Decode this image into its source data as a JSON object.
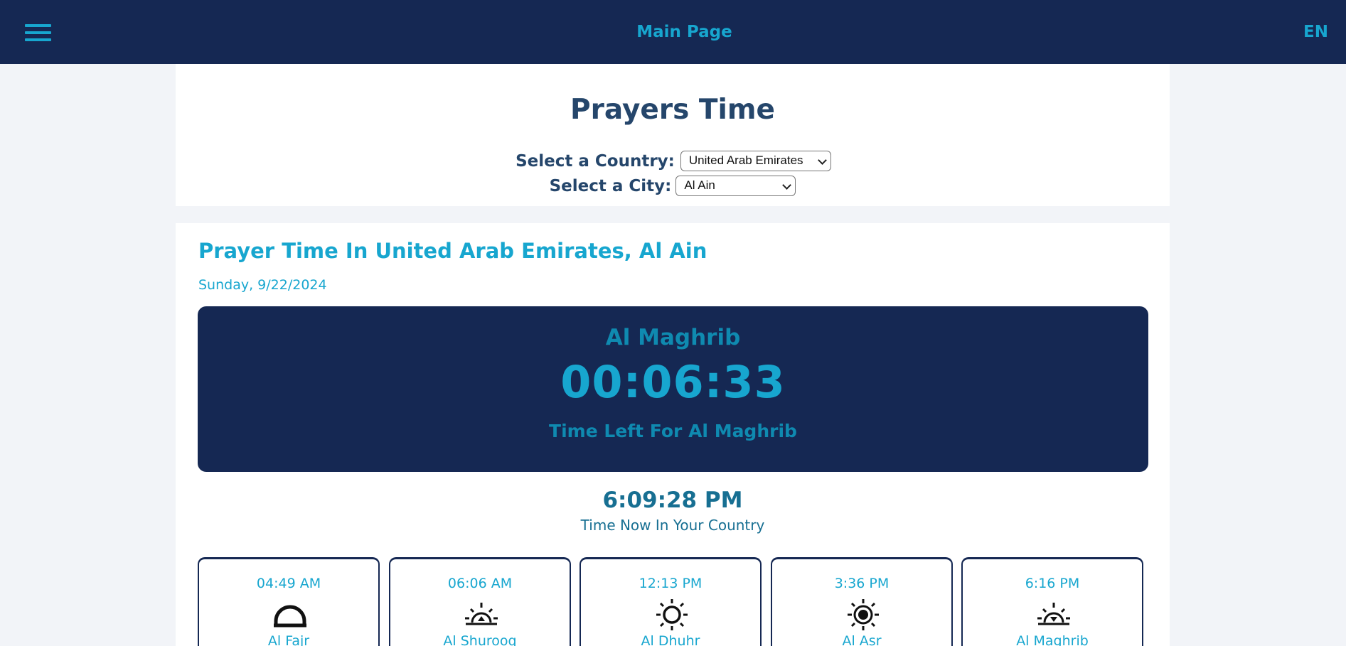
{
  "nav": {
    "title": "Main Page",
    "lang": "EN"
  },
  "header": {
    "title": "Prayers Time",
    "country_label": "Select a Country:",
    "country_value": "United Arab Emirates",
    "city_label": "Select a City:",
    "city_value": "Al Ain"
  },
  "main": {
    "heading": "Prayer Time In United Arab Emirates, Al Ain",
    "date": "Sunday, 9/22/2024",
    "next_prayer": "Al Maghrib",
    "countdown": "00:06:33",
    "time_left_label": "Time Left For Al Maghrib",
    "now_time": "6:09:28 PM",
    "now_label": "Time Now In Your Country"
  },
  "prayers": [
    {
      "time": "04:49 AM",
      "name": "Al Fajr",
      "icon": "dawn-icon"
    },
    {
      "time": "06:06 AM",
      "name": "Al Shurooq",
      "icon": "sunrise-icon"
    },
    {
      "time": "12:13 PM",
      "name": "Al Dhuhr",
      "icon": "sun-icon"
    },
    {
      "time": "3:36 PM",
      "name": "Al Asr",
      "icon": "sun-bold-icon"
    },
    {
      "time": "6:16 PM",
      "name": "Al Maghrib",
      "icon": "sunset-icon"
    }
  ],
  "colors": {
    "navy": "#152853",
    "accent": "#17a6cf",
    "heading": "#25466b",
    "muted": "#0f8ab0"
  }
}
